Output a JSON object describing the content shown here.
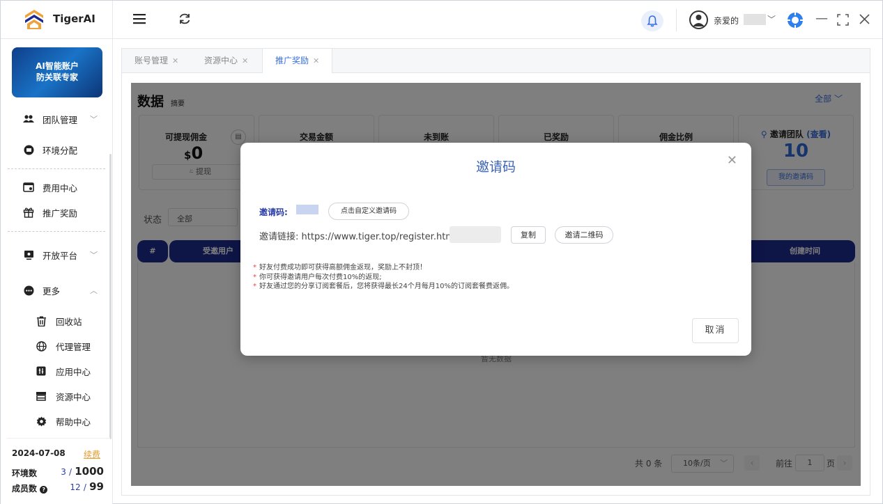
{
  "app": {
    "name": "TigerAI"
  },
  "user": {
    "greeting": "亲爱的"
  },
  "sidebar": {
    "promo": {
      "line1": "AI智能账户",
      "line2": "防关联专家"
    },
    "items": [
      {
        "label": "团队管理",
        "icon": "team-icon"
      },
      {
        "label": "环境分配",
        "icon": "env-icon"
      },
      {
        "label": "费用中心",
        "icon": "billing-icon"
      },
      {
        "label": "推广奖励",
        "icon": "gift-icon"
      },
      {
        "label": "开放平台",
        "icon": "open-platform-icon"
      },
      {
        "label": "更多",
        "icon": "more-icon"
      },
      {
        "label": "回收站",
        "icon": "trash-icon"
      },
      {
        "label": "代理管理",
        "icon": "proxy-icon"
      },
      {
        "label": "应用中心",
        "icon": "app-icon"
      },
      {
        "label": "资源中心",
        "icon": "store-icon"
      },
      {
        "label": "帮助中心",
        "icon": "gear-icon"
      }
    ],
    "quota": {
      "date": "2024-07-08",
      "renew": "续费",
      "env_label": "环境数",
      "env_used": "3",
      "env_sep": "/",
      "env_max": "1000",
      "member_label": "成员数",
      "member_used": "12",
      "member_sep": "/",
      "member_max": "99"
    }
  },
  "tabs": [
    {
      "label": "账号管理"
    },
    {
      "label": "资源中心"
    },
    {
      "label": "推广奖励",
      "active": true
    }
  ],
  "main": {
    "title": "数据",
    "subtitle": "摘要",
    "range": "全部 ﹀",
    "cards": {
      "withdrawable": {
        "title": "可提现佣金",
        "currency": "$",
        "value": "0",
        "action": "⍨ 提现"
      },
      "amount": {
        "title": "交易金额"
      },
      "pending": {
        "title": "未到账"
      },
      "rewarded": {
        "title": "已奖励"
      },
      "ratio": {
        "title": "佣金比例"
      },
      "team": {
        "title": "邀请团队",
        "view": "(查看)",
        "count": "10",
        "code_btn": "我的邀请码"
      }
    },
    "filter": {
      "label": "状态",
      "value": "全部"
    },
    "table": {
      "columns": [
        "#",
        "受邀用户",
        "创建时间"
      ],
      "empty": "暂无数据"
    },
    "pager": {
      "total": "共 0 条",
      "page_size": "10条/页",
      "goto": "前往",
      "page": "1",
      "page_suffix": "页"
    }
  },
  "modal": {
    "title": "邀请码",
    "code_label": "邀请码:",
    "custom_button": "点击自定义邀请码",
    "link_label": "邀请链接:",
    "link": "https://www.tiger.top/register.html?",
    "copy_button": "复制",
    "qr_button": "邀请二维码",
    "notes": [
      "好友付费成功即可获得高额佣金返现，奖励上不封顶！",
      "你可获得邀请用户每次付费10%的返现;",
      "好友通过您的分享订阅套餐后，您将获得最长24个月每月10%的订阅套餐费返佣。"
    ],
    "cancel_button": "取消"
  },
  "colors": {
    "accent": "#3a6fe0",
    "header": "#1d2a8f",
    "brand_orange": "#f0a23a"
  }
}
